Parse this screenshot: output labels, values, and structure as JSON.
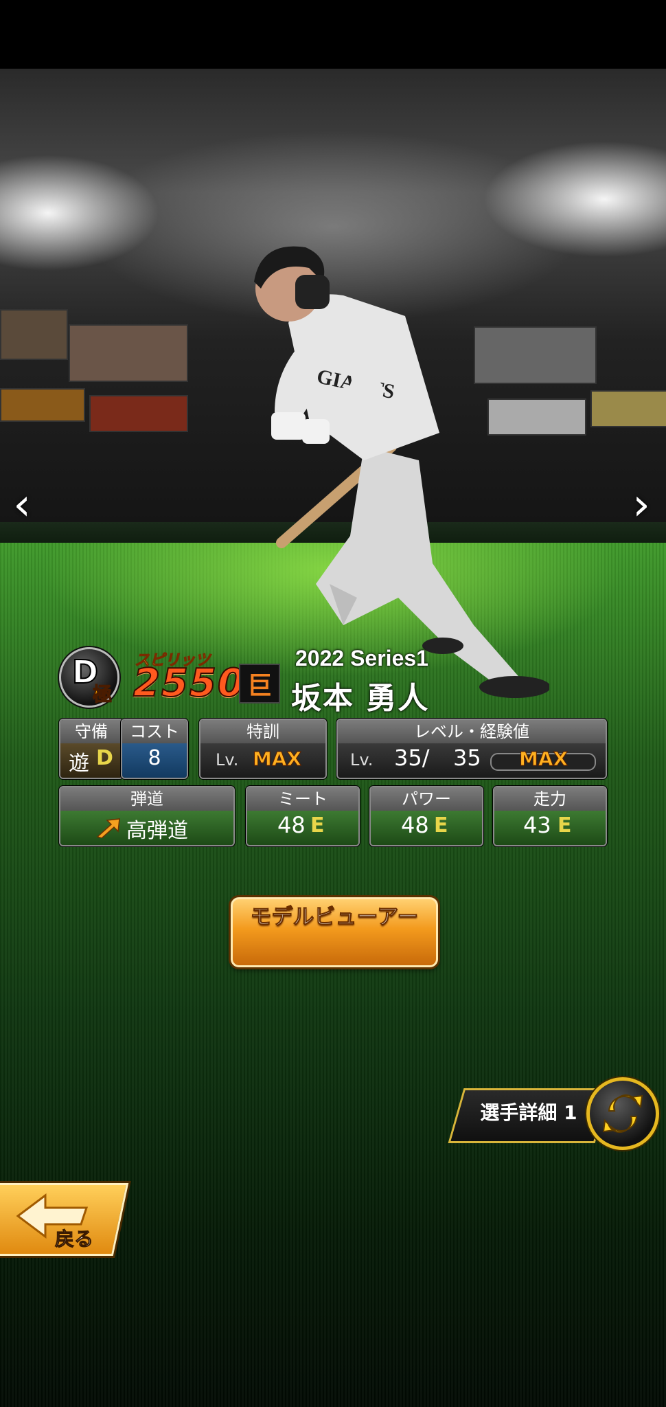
{
  "card": {
    "rank": "D",
    "rank_sub": "極",
    "spirits_label": "スピリッツ",
    "spirits_value": "2550",
    "team_logo_glyph": "巨",
    "series": "2022 Series1",
    "player_name": "坂本 勇人"
  },
  "stats": {
    "defense": {
      "label": "守備",
      "position": "遊",
      "grade": "D"
    },
    "cost": {
      "label": "コスト",
      "value": "8"
    },
    "training": {
      "label": "特訓",
      "lv_prefix": "Lv.",
      "value": "MAX"
    },
    "level": {
      "label": "レベル・経験値",
      "lv_prefix": "Lv.",
      "current": "35/",
      "max": "35",
      "exp_label": "MAX"
    },
    "trajectory": {
      "label": "弾道",
      "value": "高弾道"
    },
    "meet": {
      "label": "ミート",
      "value": "48",
      "grade": "E"
    },
    "power": {
      "label": "パワー",
      "value": "48",
      "grade": "E"
    },
    "speed": {
      "label": "走力",
      "value": "43",
      "grade": "E"
    }
  },
  "buttons": {
    "model_viewer": "モデルビューアー",
    "player_detail": "選手詳細 1",
    "back": "戻る"
  },
  "icons": {
    "prev": "chevron-left-icon",
    "next": "chevron-right-icon",
    "swap": "swap-icon",
    "back_arrow": "arrow-left-icon"
  },
  "colors": {
    "spirits": "#ff5a1f",
    "max": "#ffb020",
    "grade": "#e8d64a",
    "button_orange": "#f39a1d",
    "gold": "#e6b820"
  }
}
